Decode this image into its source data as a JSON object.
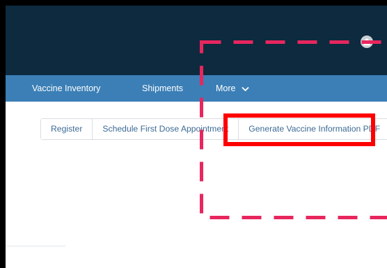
{
  "nav": {
    "items": [
      {
        "label": "Vaccine Inventory"
      },
      {
        "label": "Shipments"
      },
      {
        "label": "More"
      }
    ]
  },
  "actions": {
    "register_label": "Register",
    "schedule_label": "Schedule First Dose Appointment",
    "generate_pdf_label": "Generate Vaccine Information PDF"
  },
  "colors": {
    "header_bg": "#0d2a3f",
    "nav_bg": "#3b7fb6",
    "highlight_solid": "#ff0000",
    "highlight_dashed": "#e8265e",
    "button_text": "#3c6a94"
  },
  "icons": {
    "avatar": "user-avatar-icon",
    "more_chevron": "chevron-down-icon"
  }
}
